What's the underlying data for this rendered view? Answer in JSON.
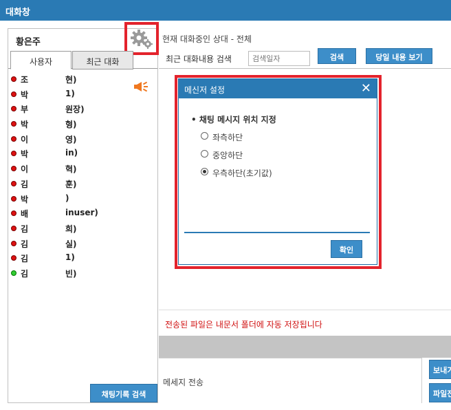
{
  "window": {
    "title": "대화창"
  },
  "sidebar": {
    "current_user": "황은주",
    "tabs": [
      {
        "label": "사용자",
        "active": true
      },
      {
        "label": "최근 대화",
        "active": false
      }
    ],
    "users": [
      {
        "name": "조",
        "detail": "현)",
        "status": "offline"
      },
      {
        "name": "박",
        "detail": "1)",
        "status": "offline"
      },
      {
        "name": "부",
        "detail": "원장)",
        "status": "offline"
      },
      {
        "name": "박",
        "detail": "형)",
        "status": "offline"
      },
      {
        "name": "이",
        "detail": "영)",
        "status": "offline"
      },
      {
        "name": "박",
        "detail": "in)",
        "status": "offline"
      },
      {
        "name": "이",
        "detail": "혁)",
        "status": "offline"
      },
      {
        "name": "김",
        "detail": "훈)",
        "status": "offline"
      },
      {
        "name": "박",
        "detail": ")",
        "status": "offline"
      },
      {
        "name": "배",
        "detail": "inuser)",
        "status": "offline"
      },
      {
        "name": "김",
        "detail": "희)",
        "status": "offline"
      },
      {
        "name": "김",
        "detail": "실)",
        "status": "offline"
      },
      {
        "name": "김",
        "detail": "1)",
        "status": "offline"
      },
      {
        "name": "김",
        "detail": "빈)",
        "status": "online"
      }
    ],
    "history_button": "채팅기록 검색"
  },
  "main": {
    "current_chat": "현재 대화중인 상대 -  전체",
    "search_label": "최근 대화내용 검색",
    "search_placeholder": "검색일자",
    "search_button": "검색",
    "today_button": "당일 내용 보기",
    "notice": "전송된 파일은 내문서 폴더에 자동 저장됩니다",
    "compose_label": "메세지 전송",
    "send_button": "보내기",
    "file_button": "파일전송"
  },
  "modal": {
    "title": "메신저 설정",
    "section_title": "• 채팅 메시지 위치 지정",
    "options": [
      {
        "label": "좌측하단",
        "checked": false
      },
      {
        "label": "중앙하단",
        "checked": false
      },
      {
        "label": "우측하단(초기값)",
        "checked": true
      }
    ],
    "ok_button": "확인"
  },
  "colors": {
    "titlebar": "#2a7ab4",
    "button": "#3d8ec9",
    "highlight": "#e3232c",
    "notice": "#d01010"
  }
}
